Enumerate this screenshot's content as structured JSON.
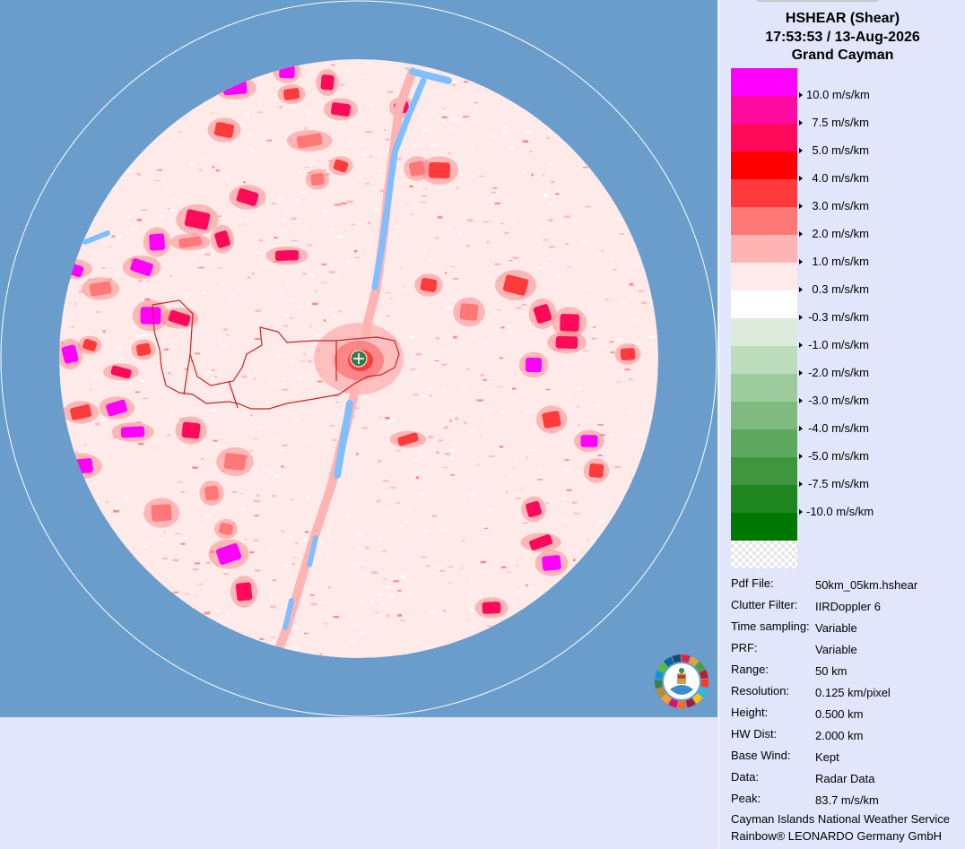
{
  "header": {
    "product": "HSHEAR (Shear)",
    "datetime": "17:53:53 / 13-Aug-2026",
    "site": "Grand Cayman"
  },
  "colors": {
    "background_ocean": "#6a9ccc",
    "panel": "#e1e6fb",
    "island_outline": "#cc2222",
    "radar_site": "#3a7a4a",
    "water_return": "#7fbfff"
  },
  "legend": [
    {
      "label": "10.0 m/s/km",
      "color": "#ff00ff"
    },
    {
      "label": "7.5 m/s/km",
      "color": "#ff0aa0"
    },
    {
      "label": "5.0 m/s/km",
      "color": "#ff0a5a"
    },
    {
      "label": "4.0 m/s/km",
      "color": "#ff0000"
    },
    {
      "label": "3.0 m/s/km",
      "color": "#ff3a3a"
    },
    {
      "label": "2.0 m/s/km",
      "color": "#ff7878"
    },
    {
      "label": "1.0 m/s/km",
      "color": "#ffb4b4"
    },
    {
      "label": "0.3 m/s/km",
      "color": "#ffeaea"
    },
    {
      "label": "-0.3 m/s/km",
      "color": "#ffffff"
    },
    {
      "label": "-1.0 m/s/km",
      "color": "#dcebdc"
    },
    {
      "label": "-2.0 m/s/km",
      "color": "#bcdcbc"
    },
    {
      "label": "-3.0 m/s/km",
      "color": "#9ecb9e"
    },
    {
      "label": "-4.0 m/s/km",
      "color": "#7fba7f"
    },
    {
      "label": "-5.0 m/s/km",
      "color": "#5fa85f"
    },
    {
      "label": "-7.5 m/s/km",
      "color": "#3f963f"
    },
    {
      "label": "-10.0 m/s/km",
      "color": "#208620"
    },
    {
      "label": "",
      "color": "#007800"
    }
  ],
  "info": [
    {
      "key": "Pdf File:",
      "value": "50km_05km.hshear"
    },
    {
      "key": "Clutter Filter:",
      "value": "IIRDoppler 6"
    },
    {
      "key": "Time sampling:",
      "value": "Variable"
    },
    {
      "key": "PRF:",
      "value": "Variable"
    },
    {
      "key": "Range:",
      "value": "50 km"
    },
    {
      "key": "Resolution:",
      "value": "0.125 km/pixel"
    },
    {
      "key": "Height:",
      "value": "0.500 km"
    },
    {
      "key": "HW Dist:",
      "value": "2.000 km"
    },
    {
      "key": "Base Wind:",
      "value": "Kept"
    },
    {
      "key": "Data:",
      "value": "Radar Data"
    },
    {
      "key": "Peak:",
      "value": "83.7 m/s/km"
    }
  ],
  "credits": {
    "line1": "Cayman Islands National Weather Service",
    "line2": "Rainbow® LEONARDO Germany GmbH"
  },
  "logo": {
    "icon": "cayman-islands-nws-logo"
  }
}
